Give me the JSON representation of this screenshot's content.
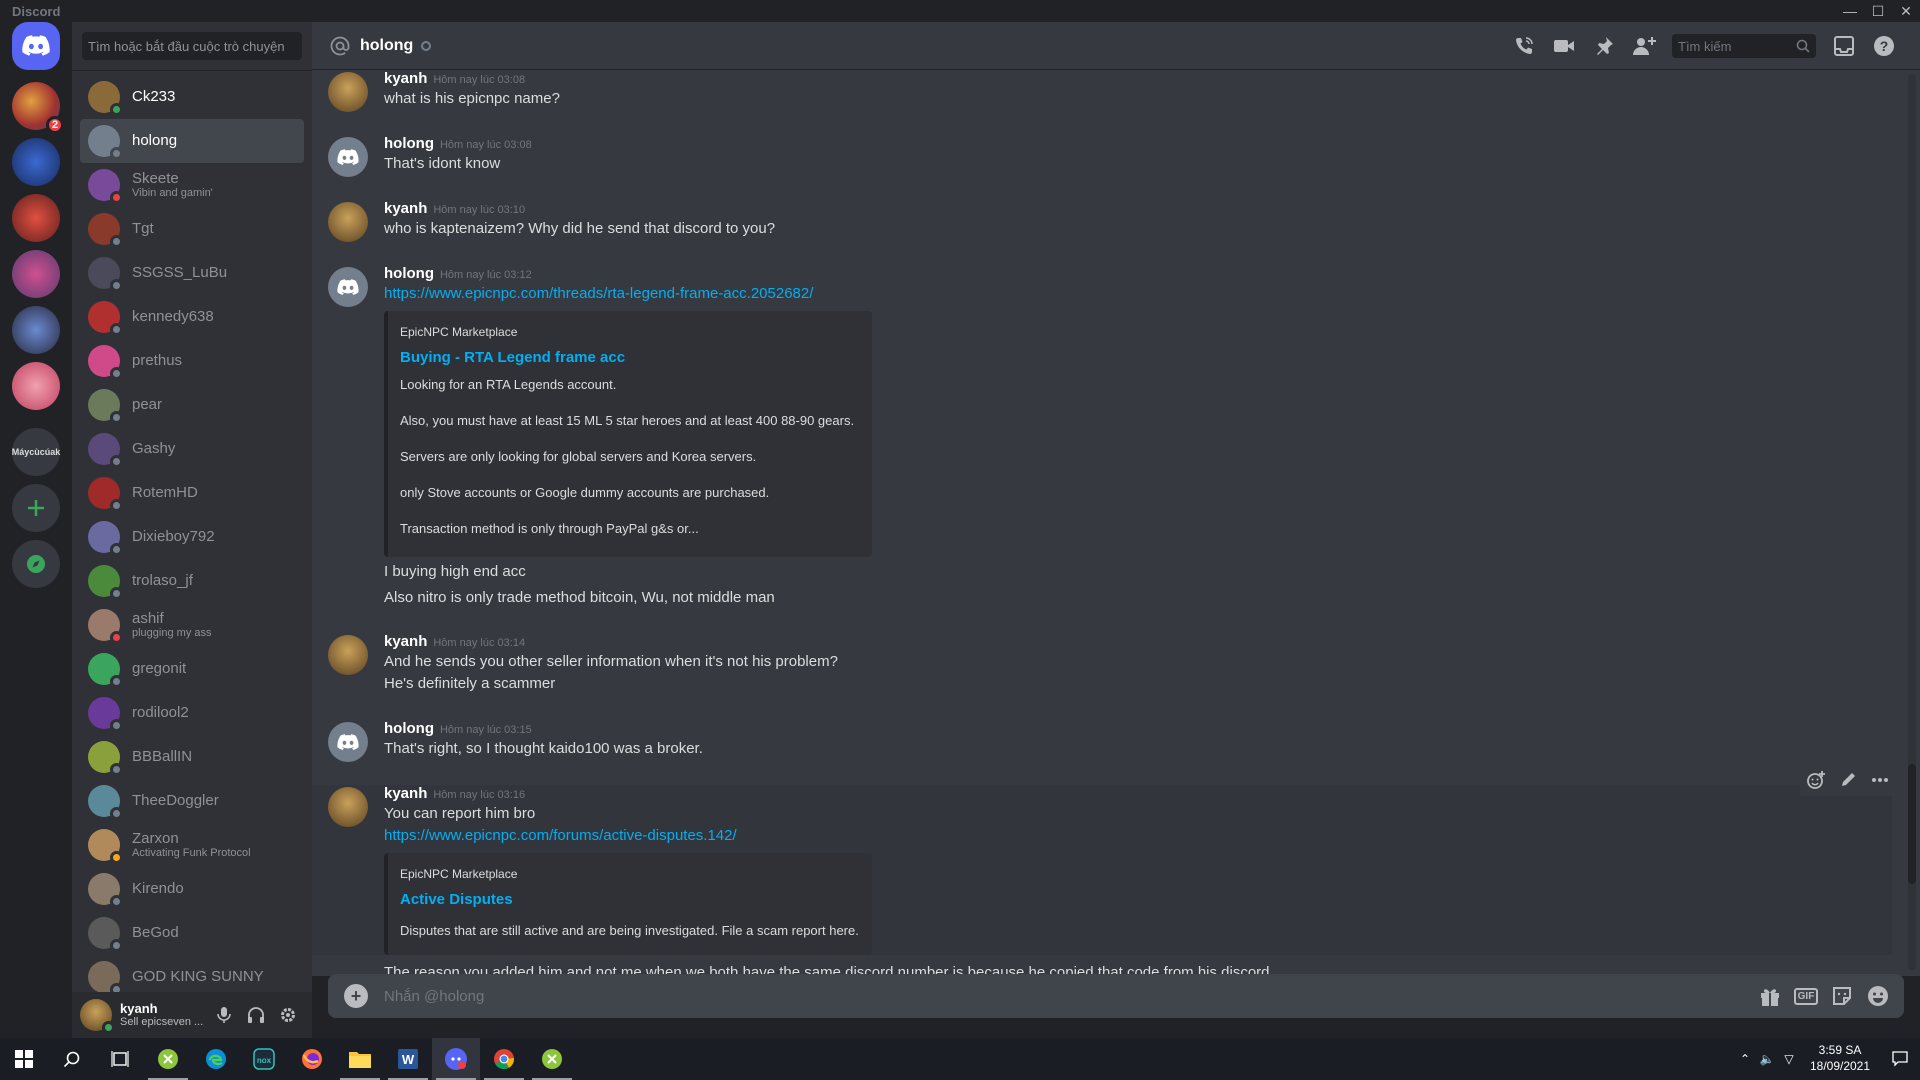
{
  "window": {
    "app_name": "Discord",
    "controls": [
      "minimize",
      "maximize",
      "close"
    ]
  },
  "guilds": [
    {
      "name": "home",
      "icon": "discord-logo-icon",
      "selected": true
    },
    {
      "name": "server-1",
      "badge": "2"
    },
    {
      "name": "server-2"
    },
    {
      "name": "server-3"
    },
    {
      "name": "server-4"
    },
    {
      "name": "server-5"
    },
    {
      "name": "server-6"
    },
    {
      "name": "server-text",
      "label": "Máycùcúak"
    },
    {
      "name": "add-server",
      "icon": "plus-icon"
    },
    {
      "name": "explore",
      "icon": "compass-icon"
    }
  ],
  "dm_sidebar": {
    "search_placeholder": "Tìm hoặc bắt đầu cuộc trò chuyện",
    "items": [
      {
        "name": "Ck233",
        "status": "online",
        "color": "#8b6a3a",
        "bold": true
      },
      {
        "name": "holong",
        "status": "offline",
        "color": "#747f8d",
        "active": true
      },
      {
        "name": "Skeete",
        "sub": "Vibin and gamin'",
        "status": "dnd",
        "color": "#7a4a9a"
      },
      {
        "name": "Tgt",
        "status": "offline",
        "color": "#8a3a2a"
      },
      {
        "name": "SSGSS_LuBu",
        "status": "offline",
        "color": "#4a4a5a"
      },
      {
        "name": "kennedy638",
        "status": "offline",
        "color": "#b03030"
      },
      {
        "name": "prethus",
        "status": "offline",
        "color": "#d04a8a"
      },
      {
        "name": "pear",
        "status": "offline",
        "color": "#6a7a5a"
      },
      {
        "name": "Gashy",
        "status": "offline",
        "color": "#5a4a7a"
      },
      {
        "name": "RotemHD",
        "status": "offline",
        "color": "#a02a2a"
      },
      {
        "name": "Dixieboy792",
        "status": "offline",
        "color": "#6a6aa0"
      },
      {
        "name": "trolaso_jf",
        "status": "offline",
        "color": "#4a8a3a"
      },
      {
        "name": "ashif",
        "sub": "plugging my ass",
        "status": "dnd",
        "color": "#9a7a6a"
      },
      {
        "name": "gregonit",
        "status": "offline",
        "color": "#3ba55d"
      },
      {
        "name": "rodilool2",
        "status": "offline",
        "color": "#6a3a9a"
      },
      {
        "name": "BBBallIN",
        "status": "offline",
        "color": "#8aa03a"
      },
      {
        "name": "TheeDoggler",
        "status": "offline",
        "color": "#5a8a9a"
      },
      {
        "name": "Zarxon",
        "sub": "Activating Funk Protocol",
        "status": "idle",
        "color": "#b08a5a"
      },
      {
        "name": "Kirendo",
        "status": "offline",
        "color": "#8a7a6a"
      },
      {
        "name": "BeGod",
        "status": "offline",
        "color": "#5a5a5a"
      },
      {
        "name": "GOD KING SUNNY",
        "status": "offline",
        "color": "#7a6a5a"
      }
    ]
  },
  "user_panel": {
    "name": "kyanh",
    "status_text": "Sell epicseven ...",
    "status": "online"
  },
  "chat_header": {
    "channel": "holong",
    "search_placeholder": "Tìm kiếm",
    "icons": [
      "phone-icon",
      "video-icon",
      "pin-icon",
      "add-friend-icon",
      "inbox-icon",
      "help-icon"
    ]
  },
  "messages": [
    {
      "author": "kyanh",
      "time": "Hôm nay lúc 03:08",
      "lines": [
        "what is his epicnpc name?"
      ]
    },
    {
      "author": "holong",
      "time": "Hôm nay lúc 03:08",
      "lines": [
        "That's idont know"
      ]
    },
    {
      "author": "kyanh",
      "time": "Hôm nay lúc 03:10",
      "lines": [
        "who is kaptenaizem? Why did he send that discord to you?"
      ]
    },
    {
      "author": "holong",
      "time": "Hôm nay lúc 03:12",
      "link": "https://www.epicnpc.com/threads/rta-legend-frame-acc.2052682/",
      "embed": {
        "provider": "EpicNPC Marketplace",
        "title": "Buying - RTA Legend frame acc",
        "desc": [
          "Looking for an RTA Legends account.",
          "Also, you must have at least 15 ML 5 star heroes and at least 400 88-90 gears.",
          "Servers are only looking for global servers and Korea servers.",
          "only Stove accounts or Google dummy accounts are purchased.",
          "Transaction method is only through PayPal g&s or..."
        ]
      },
      "after": [
        "I buying high end acc",
        "Also nitro is only trade method bitcoin, Wu, not middle man"
      ]
    },
    {
      "author": "kyanh",
      "time": "Hôm nay lúc 03:14",
      "lines": [
        "And he sends you other seller information when it's not his problem?",
        "He's definitely a scammer"
      ]
    },
    {
      "author": "holong",
      "time": "Hôm nay lúc 03:15",
      "lines": [
        "That's right, so I thought kaido100 was a broker."
      ]
    },
    {
      "author": "kyanh",
      "time": "Hôm nay lúc 03:16",
      "lines": [
        "You can report him bro"
      ],
      "link": "https://www.epicnpc.com/forums/active-disputes.142/",
      "embed": {
        "provider": "EpicNPC Marketplace",
        "title": "Active Disputes",
        "desc": [
          "Disputes that are still active and are being investigated. File a scam report here."
        ]
      }
    },
    {
      "partial_line": "The reason you added him and not me when we both have the same discord number is because he copied that code from his discord"
    }
  ],
  "composer": {
    "placeholder": "Nhắn @holong",
    "icons": [
      "gift-icon",
      "gif-icon",
      "sticker-icon",
      "emoji-icon"
    ],
    "gif_label": "GIF"
  },
  "taskbar": {
    "apps": [
      "windows-start-icon",
      "search-icon",
      "task-view-icon",
      "app-green-icon",
      "edge-icon",
      "nox-icon",
      "firefox-icon",
      "file-explorer-icon",
      "word-icon",
      "discord-icon",
      "chrome-icon",
      "app-green2-icon"
    ],
    "time": "3:59 SA",
    "date": "18/09/2021"
  },
  "colors": {
    "accent": "#5865f2",
    "link": "#00aff4",
    "online": "#3ba55d",
    "dnd": "#ed4245",
    "idle": "#faa61a",
    "offline": "#747f8d"
  }
}
